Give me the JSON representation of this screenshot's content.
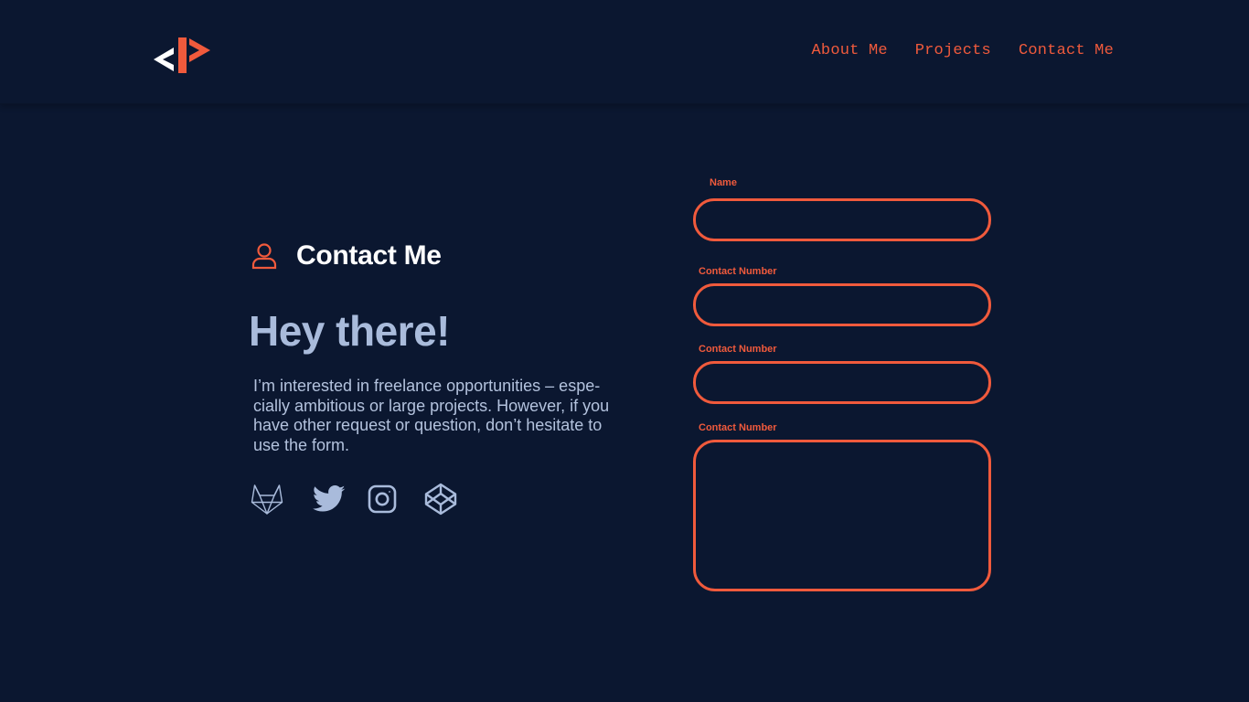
{
  "header": {
    "logo_icon": "code-bracket-logo-icon",
    "nav": [
      {
        "label": "About Me"
      },
      {
        "label": "Projects"
      },
      {
        "label": "Contact Me"
      }
    ]
  },
  "contact": {
    "section_icon": "user-icon",
    "section_title": "Contact Me",
    "greeting": "Hey there!",
    "intro_lines": [
      "I’m interested in freelance opportunities – espe-",
      "cially ambitious or large projects. However, if you",
      "have other request or question, don’t hesitate to",
      "use the form."
    ],
    "socials": [
      {
        "icon": "gitlab-icon"
      },
      {
        "icon": "twitter-icon"
      },
      {
        "icon": "instagram-icon"
      },
      {
        "icon": "codepen-icon"
      }
    ]
  },
  "form": {
    "fields": [
      {
        "label": "Name",
        "value": "",
        "placeholder": ""
      },
      {
        "label": "Contact Number",
        "value": "",
        "placeholder": ""
      },
      {
        "label": "Contact Number",
        "value": "",
        "placeholder": ""
      },
      {
        "label": "Contact Number",
        "value": "",
        "placeholder": ""
      }
    ]
  },
  "colors": {
    "background": "#0b1730",
    "accent": "#f05a3c",
    "heading_light": "#a9bbdb",
    "text": "#b3c2dd",
    "white": "#ffffff"
  }
}
